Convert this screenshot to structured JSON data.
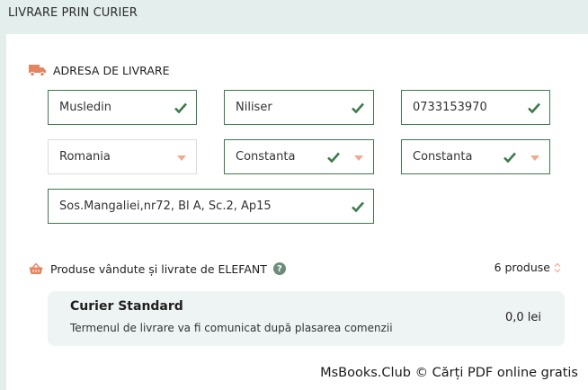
{
  "section": {
    "title": "LIVRARE PRIN CURIER"
  },
  "address": {
    "heading": "ADRESA DE LIVRARE",
    "icon": "truck-icon",
    "first_name": "Musledin",
    "last_name": "Niliser",
    "phone": "0733153970",
    "country": "Romania",
    "county": "Constanta",
    "city": "Constanta",
    "street": "Sos.Mangaliei,nr72, Bl A, Sc.2, Ap15"
  },
  "products": {
    "icon": "basket-icon",
    "label": "Produse vândute și livrate de ELEFANT",
    "help": "?",
    "count": "6 produse"
  },
  "shipping": {
    "title": "Curier Standard",
    "description": "Termenul de livrare va fi comunicat după plasarea comenzii",
    "price": "0,0 lei"
  },
  "watermark": "MsBooks.Club © Cărți PDF online gratis",
  "colors": {
    "accent_green": "#3d7a4a",
    "caret_orange": "#f0a98c",
    "truck_orange": "#e8835f",
    "page_bg": "#e4efed",
    "card_bg": "#eef3f4"
  }
}
